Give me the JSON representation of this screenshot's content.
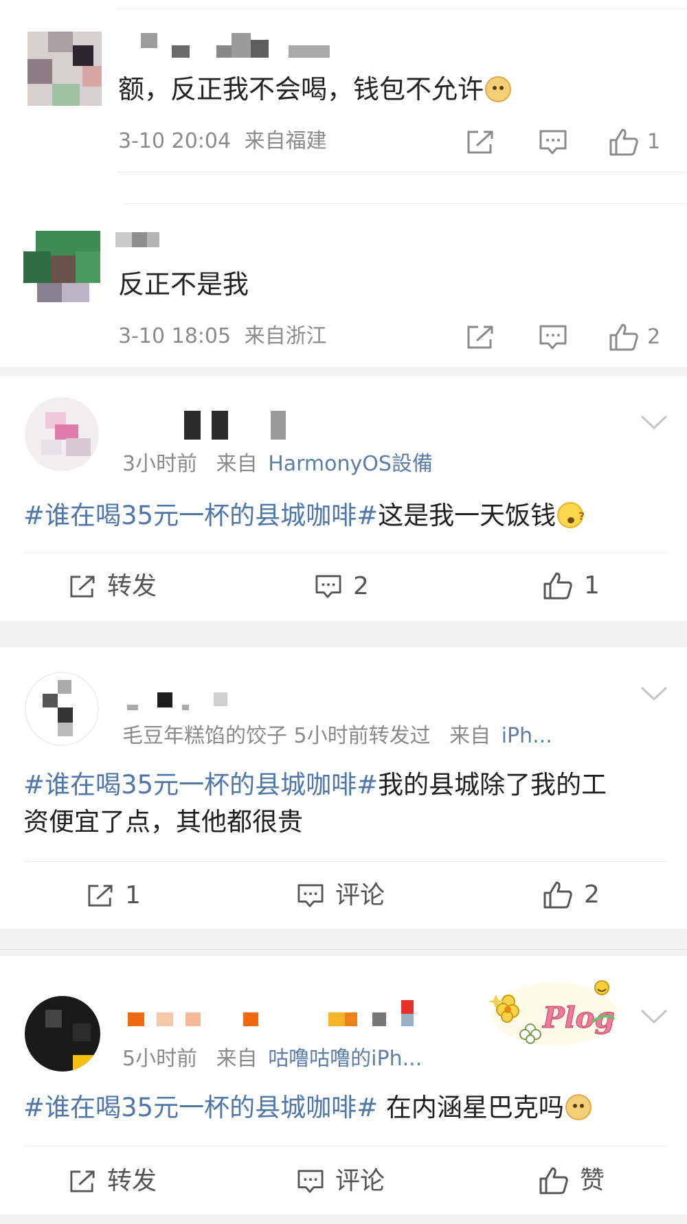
{
  "comments": [
    {
      "text": "额，反正我不会喝，钱包不允许",
      "emoji": "doge-emoji",
      "time": "3-10 20:04",
      "location": "来自福建",
      "likes": "1"
    },
    {
      "text": "反正不是我",
      "time": "3-10 18:05",
      "location": "来自浙江",
      "likes": "2"
    }
  ],
  "posts": [
    {
      "time": "3小时前",
      "from_prefix": "来自",
      "source": "HarmonyOS設備",
      "topic": "#谁在喝35元一杯的县城咖啡#",
      "body": "这是我一天饭钱",
      "emoji": "wonder-emoji",
      "repost_label": "转发",
      "comment_label": "2",
      "like_label": "1"
    },
    {
      "repost_info": "毛豆年糕馅的饺子 5小时前转发过",
      "from_prefix": "来自",
      "source": "iPh...",
      "topic": "#谁在喝35元一杯的县城咖啡#",
      "body_line1": "我的县城除了我的工",
      "body_line2": "资便宜了点，其他都很贵",
      "repost_label": "1",
      "comment_label": "评论",
      "like_label": "2"
    },
    {
      "time": "5小时前",
      "from_prefix": "来自",
      "source": "咕噜咕噜的iPh...",
      "topic": "#谁在喝35元一杯的县城咖啡#",
      "body": " 在内涵星巴克吗",
      "emoji": "doge-emoji",
      "sticker_text": "Plog",
      "repost_label": "转发",
      "comment_label": "评论",
      "like_label": "赞"
    }
  ],
  "colors": {
    "topic": "#4f76a8",
    "meta": "#8a8a8a",
    "divider": "#ececec",
    "gap": "#f2f2f2"
  }
}
